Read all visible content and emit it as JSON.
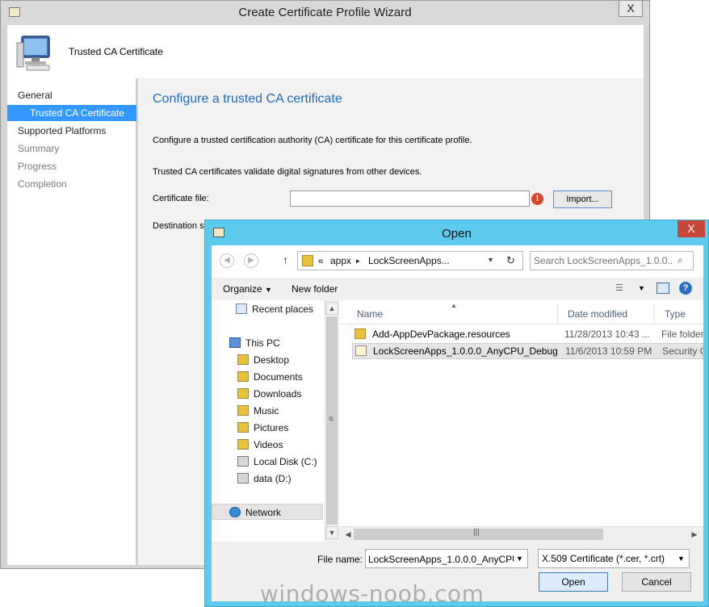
{
  "wizard": {
    "title": "Create Certificate Profile Wizard",
    "close_glyph": "X",
    "header_title": "Trusted CA Certificate",
    "nav": [
      {
        "label": "General",
        "state": "normal"
      },
      {
        "label": "Trusted CA Certificate",
        "state": "selected"
      },
      {
        "label": "Supported Platforms",
        "state": "normal"
      },
      {
        "label": "Summary",
        "state": "dim"
      },
      {
        "label": "Progress",
        "state": "dim"
      },
      {
        "label": "Completion",
        "state": "dim"
      }
    ],
    "content": {
      "heading": "Configure a trusted CA certificate",
      "description": "Configure a trusted certification authority (CA) certificate for this certificate profile.",
      "info": "Trusted CA certificates validate digital signatures from other devices.",
      "certificate_file_label": "Certificate file:",
      "certificate_file_value": "",
      "error_glyph": "!",
      "import_button": "Import...",
      "destination_label": "Destination st"
    },
    "accent_color": "#1e6cb6",
    "selection_color": "#3399ff"
  },
  "open_dialog": {
    "title": "Open",
    "close_glyph": "X",
    "address": {
      "crumbs": [
        "«",
        "appx",
        "▸",
        "LockScreenApps..."
      ]
    },
    "search": {
      "placeholder": "Search LockScreenApps_1.0.0...."
    },
    "toolbar": {
      "organize": "Organize",
      "new_folder": "New folder",
      "help_glyph": "?"
    },
    "nav_items": [
      {
        "label": "Recent places",
        "icon": "clock-icon"
      },
      {
        "label": "This PC",
        "icon": "computer-icon"
      },
      {
        "label": "Desktop",
        "icon": "folder-icon"
      },
      {
        "label": "Documents",
        "icon": "folder-icon"
      },
      {
        "label": "Downloads",
        "icon": "folder-icon"
      },
      {
        "label": "Music",
        "icon": "folder-icon"
      },
      {
        "label": "Pictures",
        "icon": "folder-icon"
      },
      {
        "label": "Videos",
        "icon": "folder-icon"
      },
      {
        "label": "Local Disk (C:)",
        "icon": "drive-icon"
      },
      {
        "label": "data (D:)",
        "icon": "drive-icon"
      },
      {
        "label": "Network",
        "icon": "network-icon"
      }
    ],
    "columns": [
      "Name",
      "Date modified",
      "Type"
    ],
    "files": [
      {
        "name": "Add-AppDevPackage.resources",
        "date": "11/28/2013 10:43 ...",
        "type": "File folder",
        "icon": "folder-icon"
      },
      {
        "name": "LockScreenApps_1.0.0.0_AnyCPU_Debug",
        "date": "11/6/2013 10:59 PM",
        "type": "Security C",
        "icon": "certificate-icon"
      }
    ],
    "file_name_label": "File name:",
    "file_name_value": "LockScreenApps_1.0.0.0_AnyCPU_",
    "file_type_value": "X.509 Certificate (*.cer, *.crt)",
    "open_button": "Open",
    "cancel_button": "Cancel",
    "title_bar_color": "#5ccbee",
    "close_button_color": "#c7463a"
  },
  "watermark": "windows-noob.com"
}
